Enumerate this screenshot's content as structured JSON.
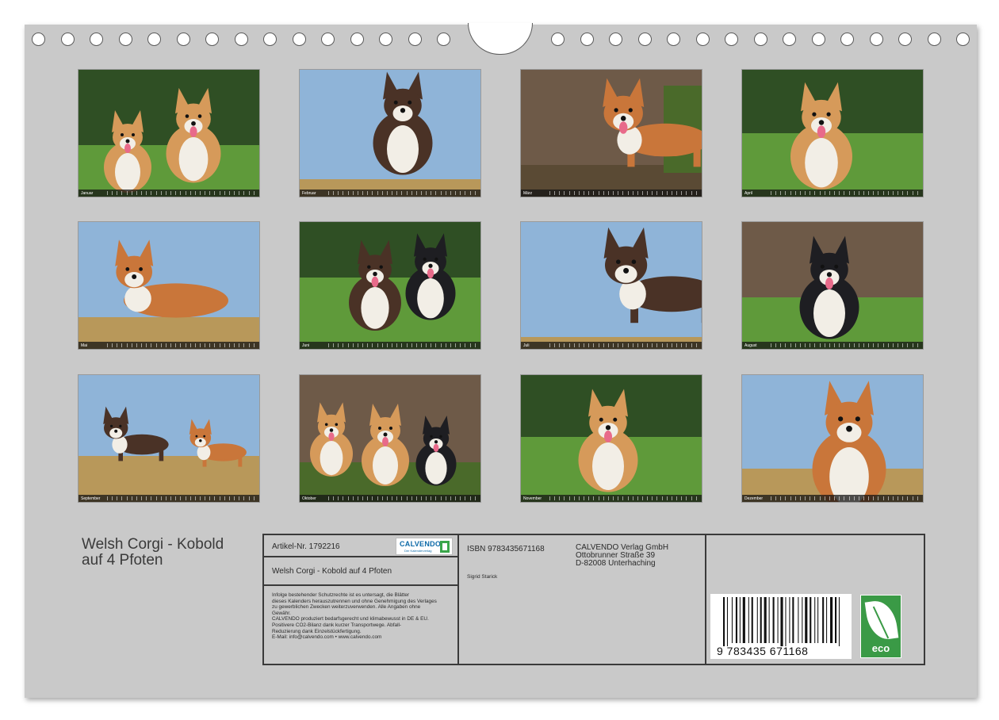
{
  "calendar": {
    "title_line1": "Welsh Corgi - Kobold",
    "title_line2": "auf 4 Pfoten",
    "months": [
      {
        "label": "Januar",
        "scene": "two-sable-corgis-grass"
      },
      {
        "label": "Februar",
        "scene": "brindle-corgi-sky"
      },
      {
        "label": "März",
        "scene": "red-corgi-tree"
      },
      {
        "label": "April",
        "scene": "fluffy-corgi-grass"
      },
      {
        "label": "Mai",
        "scene": "red-corgi-lying-sky"
      },
      {
        "label": "Juni",
        "scene": "two-brindle-corgis-grass"
      },
      {
        "label": "Juli",
        "scene": "brindle-corgi-standing-sky"
      },
      {
        "label": "August",
        "scene": "black-corgi-tree"
      },
      {
        "label": "September",
        "scene": "corgis-running-field"
      },
      {
        "label": "Oktober",
        "scene": "three-corgis-tree"
      },
      {
        "label": "November",
        "scene": "fluffy-corgi-lawn"
      },
      {
        "label": "Dezember",
        "scene": "red-corgi-portrait"
      }
    ]
  },
  "info": {
    "article": "Artikel-Nr. 1792216",
    "logo_text": "CALVENDO",
    "logo_sub": "Der Kalenderverlag",
    "product_title": "Welsh Corgi - Kobold auf 4 Pfoten",
    "notice_lines": [
      "Infolge bestehender Schutzrechte ist es untersagt, die Blätter",
      "dieses Kalenders herauszutrennen und ohne Genehmigung des Verlages",
      "zu gewerblichen Zwecken weiterzuverwenden. Alle Angaben ohne",
      "Gewähr.",
      "CALVENDO produziert bedarfsgerecht und klimabewusst in DE & EU.",
      "Positivere CO2-Bilanz dank kurzer Transportwege. Abfall-",
      "Reduzierung dank Einzelstückfertigung.",
      "E-Mail: info@calvendo.com • www.calvendo.com"
    ],
    "isbn": "ISBN 9783435671168",
    "author": "Sigrid Starick",
    "publisher_line1": "CALVENDO Verlag GmbH",
    "publisher_line2": "Ottobrunner Straße 39",
    "publisher_line3": "D-82008 Unterhaching",
    "barcode_digits": "9 783435 671168",
    "eco_label": "eco"
  },
  "colors": {
    "sheet": "#c9c9c9",
    "sky": "#8fb4d8",
    "grass": "#5f9a3a",
    "dry_grass": "#b8985a",
    "tree": "#6e5a48",
    "hedge": "#2f4f24",
    "red_coat": "#c9763a",
    "sable_coat": "#d69a5a",
    "brindle_coat": "#4a3226",
    "black_coat": "#1e1e22",
    "white_coat": "#f2eee6",
    "eco_green": "#3a9a46"
  }
}
